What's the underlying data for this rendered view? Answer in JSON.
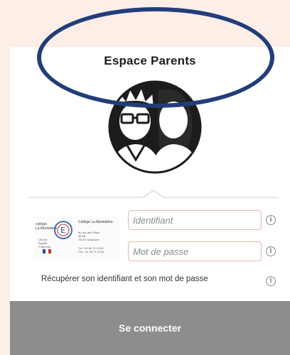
{
  "header": {
    "title": "Espace Parents"
  },
  "login": {
    "identifiant_placeholder": "Identifiant",
    "password_placeholder": "Mot de passe",
    "recover_link": "Récupérer son identifiant et son mot de passe",
    "submit_label": "Se connecter",
    "info_glyph": "i"
  },
  "logo": {
    "emblem_text": "collège\nLa Montolière",
    "college_name": "Collège La Montolière",
    "rf_text": "Liberté\nÉgalité\nFraternité",
    "address": "60 rue des Pilars\n06 66\n75170 Soissions",
    "phone": "Tél : 04 96 72 13 80\nFax : 04 96 72 13 81"
  },
  "colors": {
    "page_background": "#fdeee8",
    "annotation_oval": "#223d7a",
    "button": "#8d8d8d",
    "field_border": "#e2b9a8"
  },
  "icons": [
    "annotation-oval",
    "parents-avatar-icon",
    "info-icon"
  ]
}
